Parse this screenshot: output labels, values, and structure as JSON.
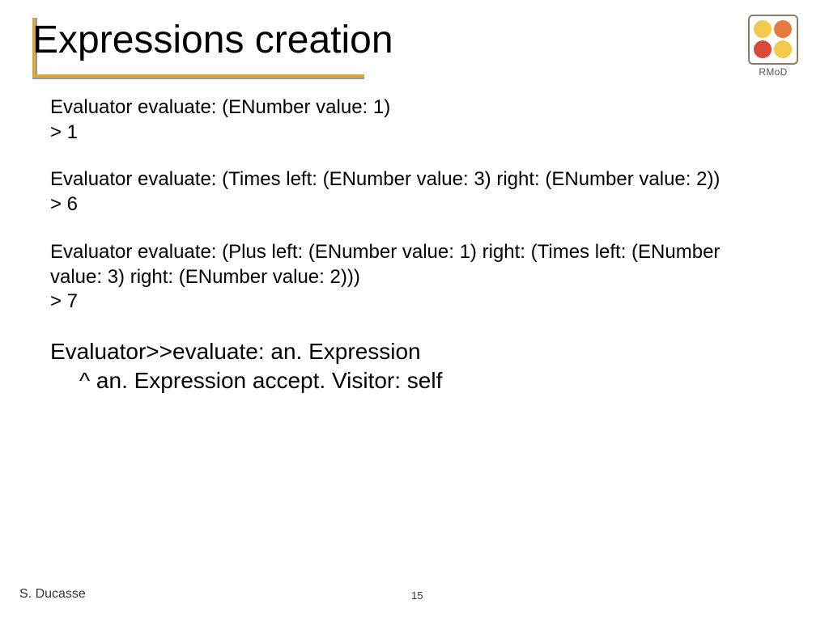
{
  "title": "Expressions creation",
  "logo": {
    "label": "RMoD"
  },
  "blocks": {
    "b1": {
      "line1": "Evaluator evaluate: (ENumber value: 1)",
      "line2": "> 1"
    },
    "b2": {
      "line1": "Evaluator evaluate: (Times left: (ENumber value: 3) right: (ENumber value: 2))",
      "line2": "> 6"
    },
    "b3": {
      "line1": "Evaluator evaluate: (Plus left: (ENumber value: 1) right: (Times left: (ENumber value: 3) right: (ENumber value: 2)))",
      "line2": "> 7"
    },
    "b4": {
      "line1": "Evaluator>>evaluate: an. Expression",
      "line2": "^ an. Expression accept. Visitor: self"
    }
  },
  "footer": {
    "author": "S. Ducasse",
    "page": "15"
  }
}
